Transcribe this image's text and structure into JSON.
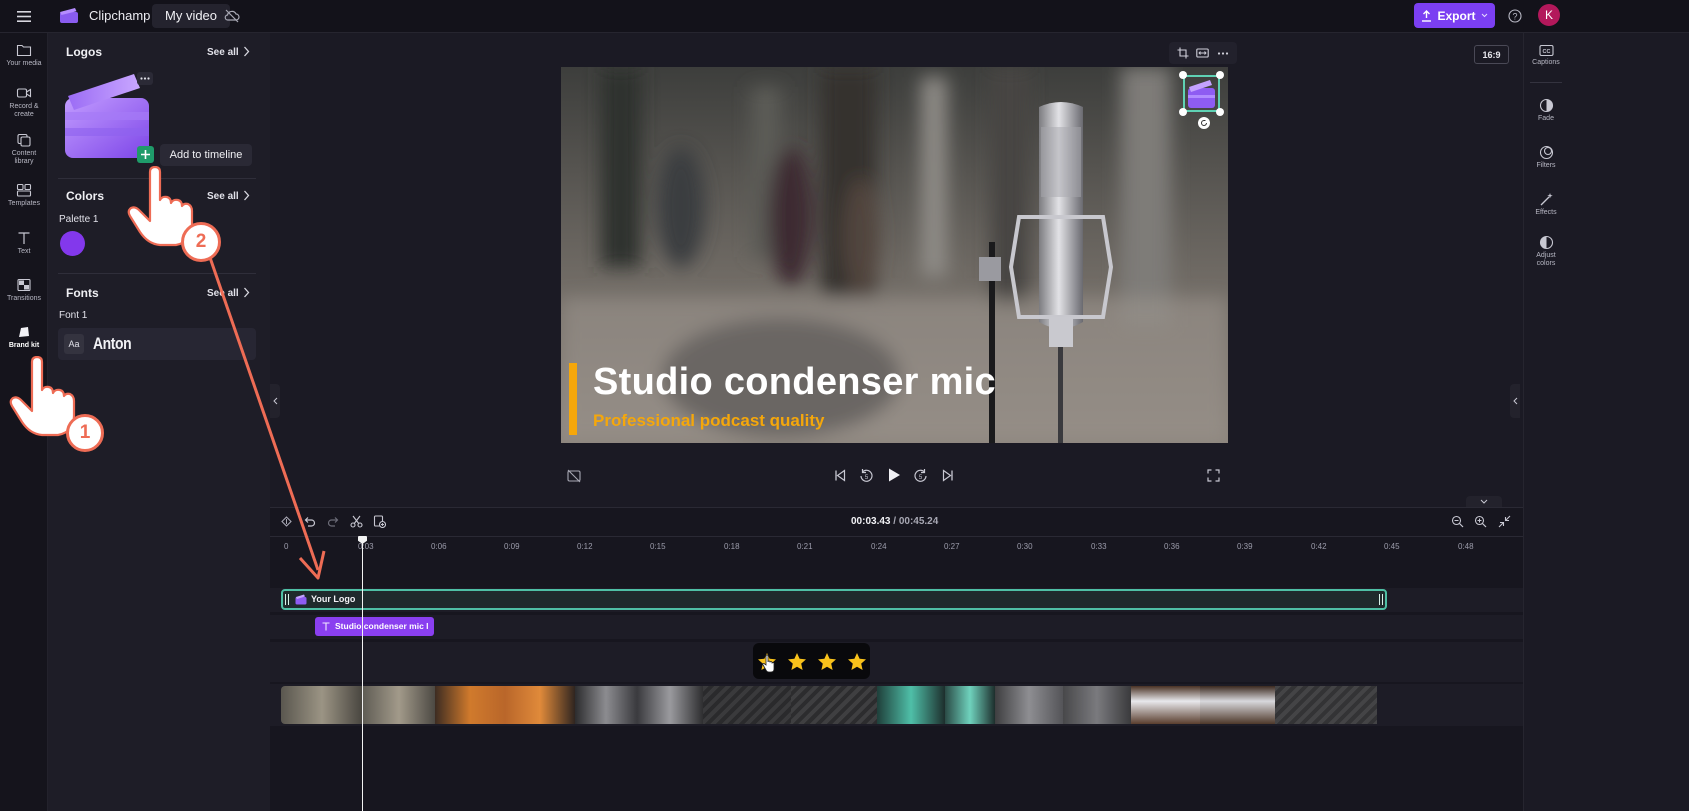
{
  "app": {
    "title": "Clipchamp",
    "video_name": "My video"
  },
  "header": {
    "export_label": "Export",
    "avatar_initial": "K"
  },
  "left_rail": {
    "items": [
      {
        "label": "Your media"
      },
      {
        "label": "Record & create"
      },
      {
        "label": "Content library"
      },
      {
        "label": "Templates"
      },
      {
        "label": "Text"
      },
      {
        "label": "Transitions"
      },
      {
        "label": "Brand kit"
      }
    ]
  },
  "brand_panel": {
    "logos": {
      "title": "Logos",
      "see_all": "See all",
      "add_to_timeline": "Add to timeline"
    },
    "colors": {
      "title": "Colors",
      "see_all": "See all",
      "palette_label": "Palette 1",
      "swatch_color": "#8338ec"
    },
    "fonts": {
      "title": "Fonts",
      "see_all": "See all",
      "font_label": "Font 1",
      "font_sample_prefix": "Aa",
      "font_name": "Anton"
    }
  },
  "preview": {
    "aspect_ratio": "16:9",
    "title_text": "Studio condenser mic",
    "subtitle_text": "Professional podcast quality",
    "accent_color": "#f5a70b"
  },
  "right_rail": {
    "items": [
      {
        "label": "Captions"
      },
      {
        "label": "Fade"
      },
      {
        "label": "Filters"
      },
      {
        "label": "Effects"
      },
      {
        "label": "Adjust colors"
      }
    ]
  },
  "timeline": {
    "current_time": "00:03.43",
    "total_time": "/ 00:45.24",
    "ticks": [
      "0",
      "0:03",
      "0:06",
      "0:09",
      "0:12",
      "0:15",
      "0:18",
      "0:21",
      "0:24",
      "0:27",
      "0:30",
      "0:33",
      "0:36",
      "0:39",
      "0:42",
      "0:45",
      "0:48"
    ],
    "logo_clip_label": "Your Logo",
    "text_clip_label": "Studio condenser mic l",
    "rating_stars": 4
  },
  "annotations": {
    "step_1": "1",
    "step_2": "2"
  }
}
